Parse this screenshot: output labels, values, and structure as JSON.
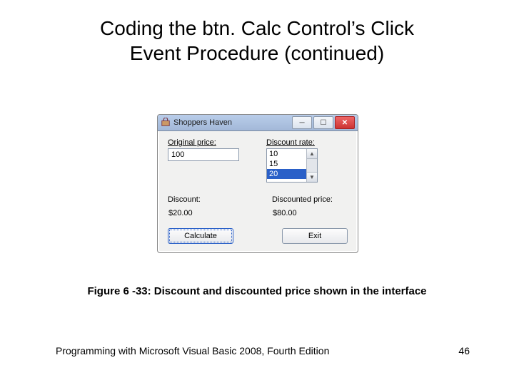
{
  "title_line1": "Coding the btn. Calc Control’s Click",
  "title_line2": "Event Procedure (continued)",
  "dialog": {
    "window_title": "Shoppers Haven",
    "labels": {
      "original_price": "Original price:",
      "discount_rate": "Discount rate:",
      "discount": "Discount:",
      "discounted_price": "Discounted price:"
    },
    "original_price_value": "100",
    "discount_rate_options": [
      "10",
      "15",
      "20"
    ],
    "discount_rate_selected": "20",
    "discount_value": "$20.00",
    "discounted_price_value": "$80.00",
    "buttons": {
      "calculate": "Calculate",
      "exit": "Exit"
    }
  },
  "caption": "Figure 6 -33: Discount and discounted price shown in the interface",
  "footer_text": "Programming with Microsoft Visual Basic 2008, Fourth Edition",
  "page_number": "46"
}
